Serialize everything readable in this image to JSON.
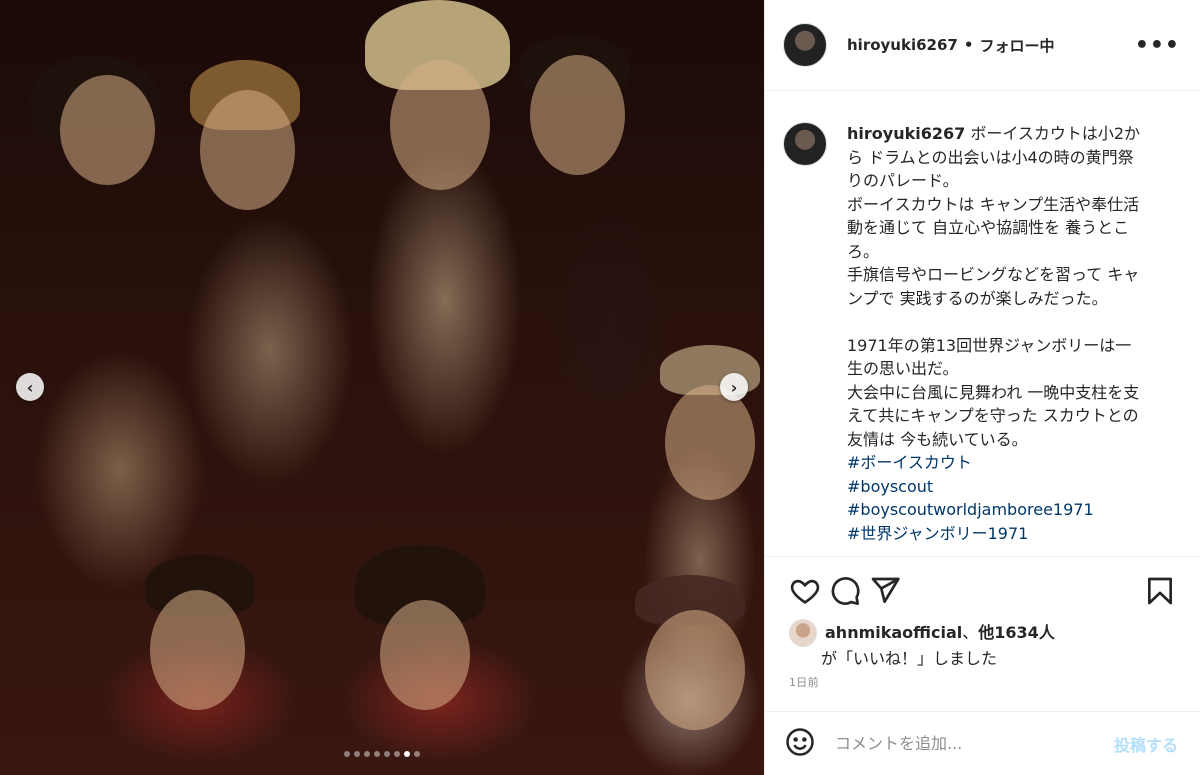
{
  "header": {
    "username": "hiroyuki6267",
    "separator": "•",
    "follow_status": "フォロー中",
    "more": "•••"
  },
  "caption": {
    "username": "hiroyuki6267",
    "text": " ボーイスカウトは小2から ドラムとの出会いは小4の時の黄門祭りのパレード。\nボーイスカウトは キャンプ生活や奉仕活動を通じて 自立心や協調性を 養うところ。\n手旗信号やロービングなどを習って キャンプで 実践するのが楽しみだった。\n\n1971年の第13回世界ジャンボリーは一生の思い出だ。\n大会中に台風に見舞われ 一晩中支柱を支えて共にキャンプを守った スカウトとの友情は 今も続いている。\n",
    "hashtags": [
      "#ボーイスカウト",
      "#boyscout",
      "#boyscoutworldjamboree1971",
      "#世界ジャンボリー1971"
    ]
  },
  "likes": {
    "liker": "ahnmikaofficial",
    "joiner": "、",
    "others": "他1634人",
    "suffix": "が「いいね！」しました"
  },
  "timestamp": "1日前",
  "comment": {
    "placeholder": "コメントを追加...",
    "post_label": "投稿する"
  },
  "carousel": {
    "prev": "‹",
    "next": "›",
    "dot_count": 8,
    "active_index": 6
  }
}
